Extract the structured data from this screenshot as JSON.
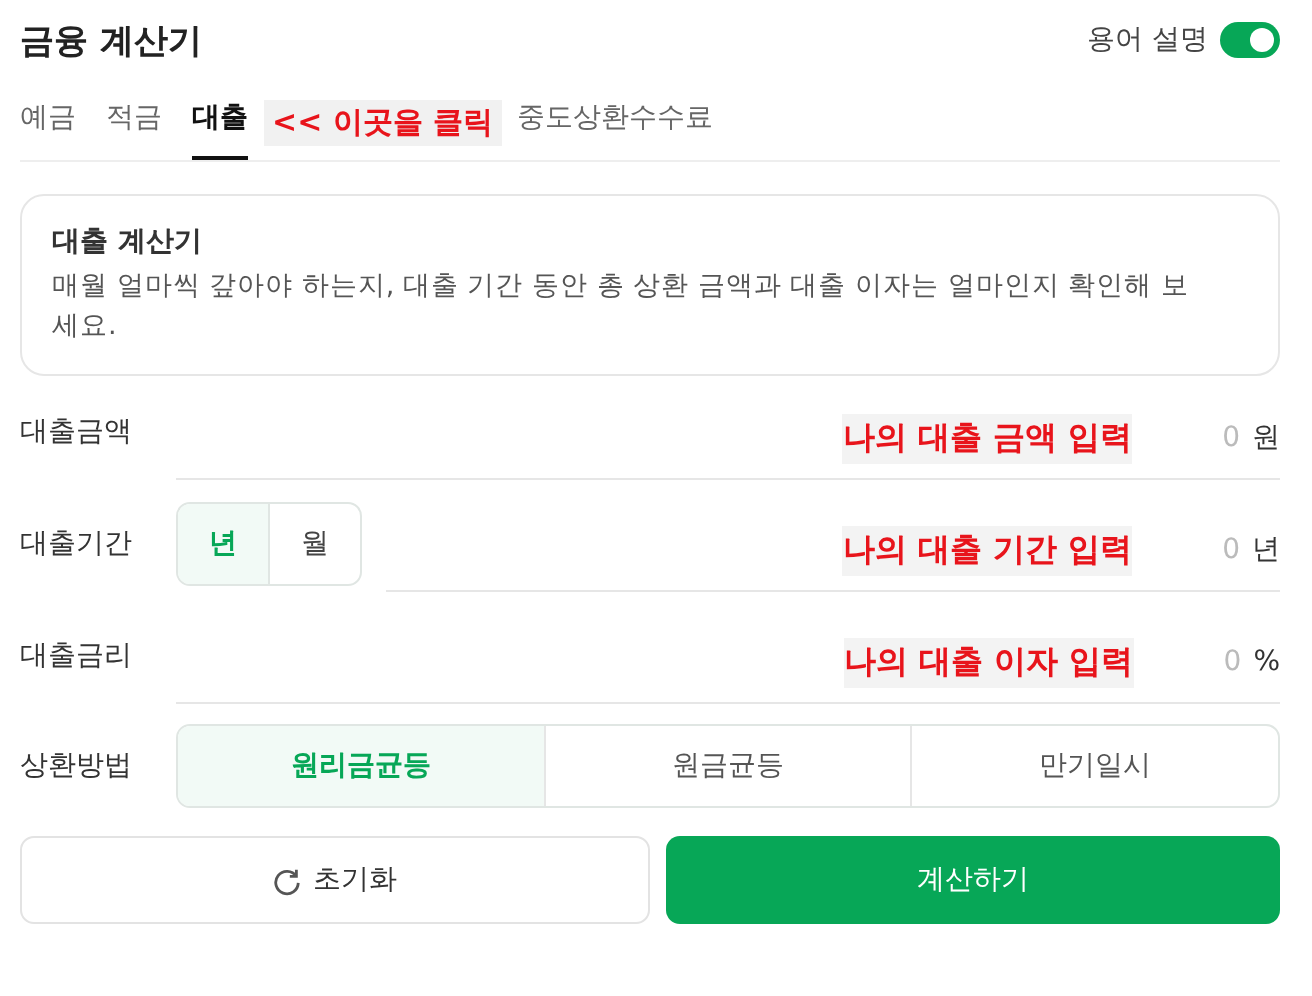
{
  "header": {
    "title": "금융 계산기",
    "toggle": {
      "label": "용어 설명",
      "on": true
    }
  },
  "tabs": [
    {
      "label": "예금",
      "selected": false
    },
    {
      "label": "적금",
      "selected": false
    },
    {
      "label": "대출",
      "selected": true
    },
    {
      "label": "중도상환수수료",
      "selected": false
    }
  ],
  "tab_annotation": "<< 이곳을 클릭",
  "intro": {
    "title": "대출 계산기",
    "text": "매월 얼마씩 갚아야 하는지, 대출 기간 동안 총 상환 금액과 대출 이자는 얼마인지 확인해 보세요."
  },
  "fields": [
    {
      "label": "대출금액",
      "kind": "plain",
      "annotation": "나의 대출 금액 입력",
      "placeholder": "0",
      "unit": "원"
    },
    {
      "label": "대출기간",
      "kind": "period",
      "options": [
        {
          "label": "년",
          "selected": true
        },
        {
          "label": "월",
          "selected": false
        }
      ],
      "annotation": "나의 대출 기간 입력",
      "placeholder": "0",
      "unit": "년"
    },
    {
      "label": "대출금리",
      "kind": "plain",
      "annotation": "나의 대출 이자 입력",
      "placeholder": "0",
      "unit": "%"
    }
  ],
  "method": {
    "label": "상환방법",
    "options": [
      {
        "label": "원리금균등",
        "selected": true
      },
      {
        "label": "원금균등",
        "selected": false
      },
      {
        "label": "만기일시",
        "selected": false
      }
    ]
  },
  "buttons": [
    {
      "label": "초기화",
      "kind": "reset"
    },
    {
      "label": "계산하기",
      "kind": "primary"
    }
  ]
}
